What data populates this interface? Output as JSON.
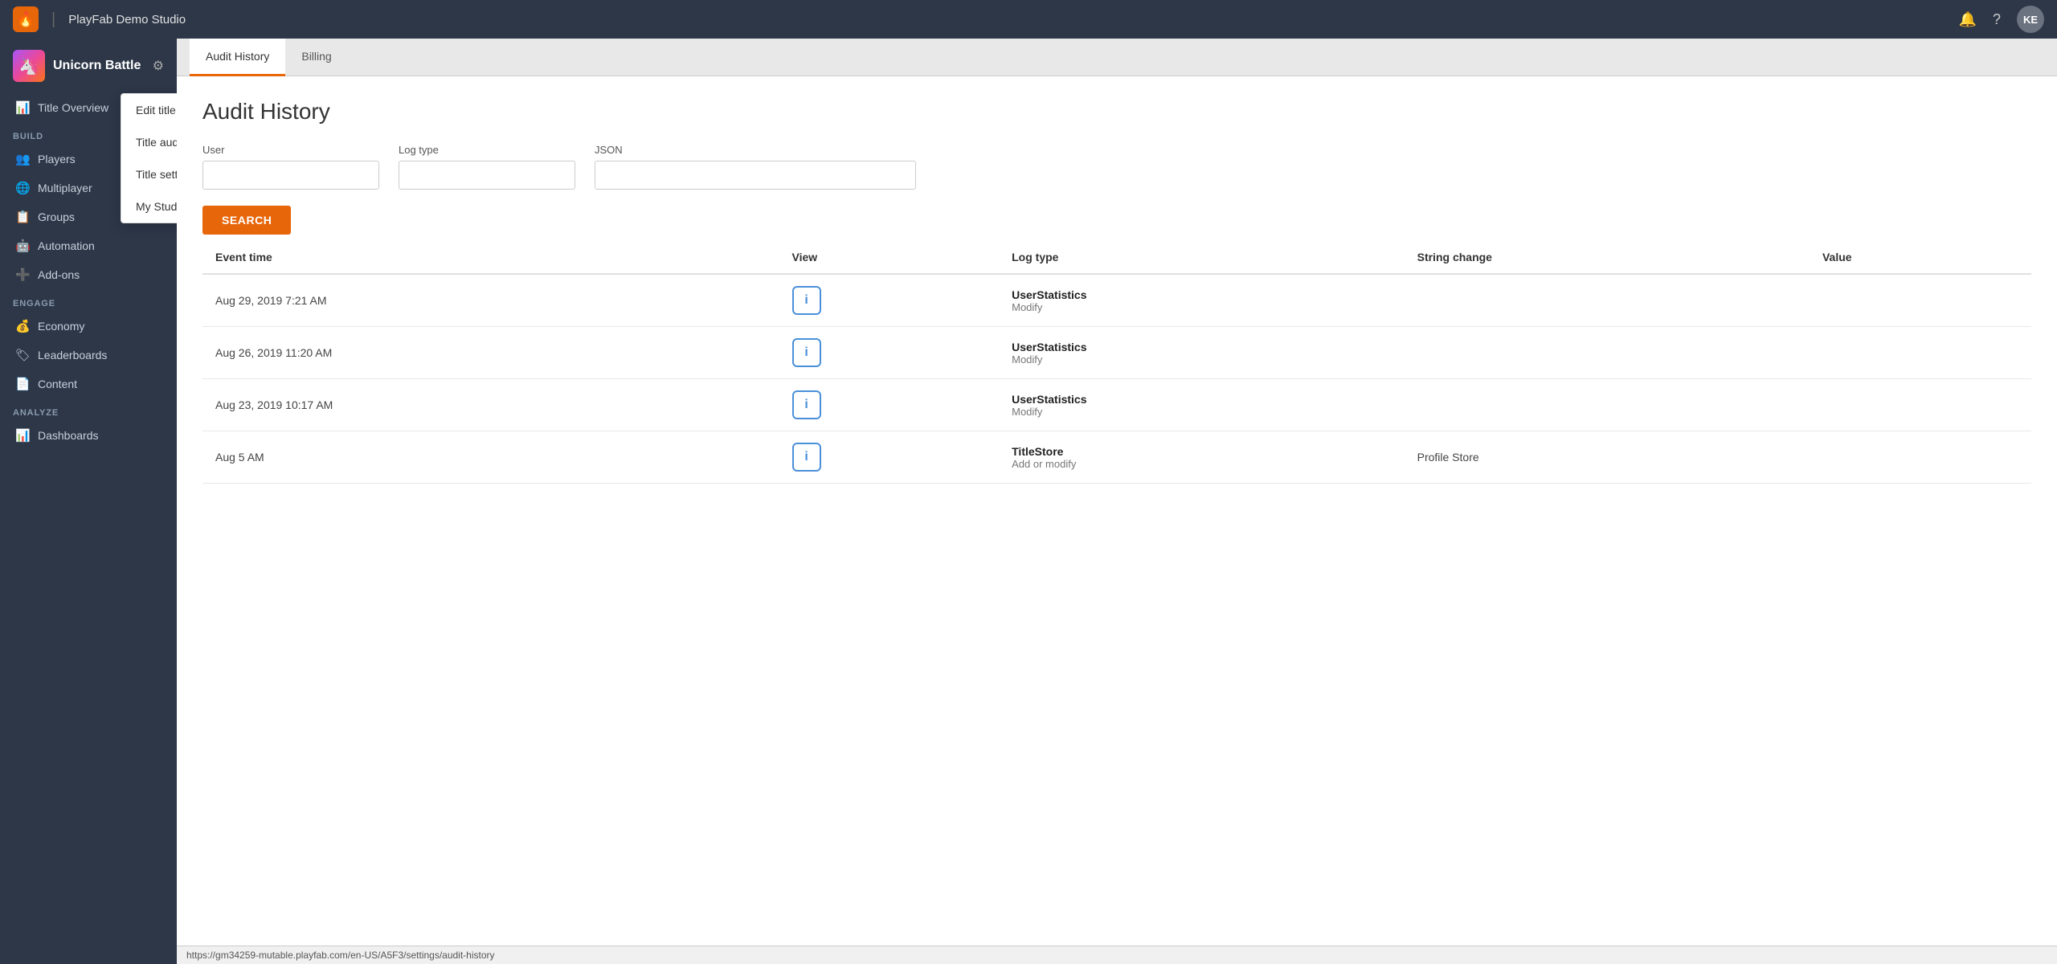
{
  "topNav": {
    "logo": "🔥",
    "studioName": "PlayFab Demo Studio",
    "divider": "|",
    "notificationIcon": "🔔",
    "helpIcon": "?",
    "avatarLabel": "KE"
  },
  "sidebar": {
    "titleName": "Unicorn Battle",
    "titleEmoji": "🦄",
    "gearLabel": "⚙",
    "overviewItem": "Title Overview",
    "buildLabel": "BUILD",
    "buildItems": [
      {
        "label": "Players",
        "icon": "👥"
      },
      {
        "label": "Multiplayer",
        "icon": "🌐"
      },
      {
        "label": "Groups",
        "icon": "📋"
      },
      {
        "label": "Automation",
        "icon": "🤖"
      },
      {
        "label": "Add-ons",
        "icon": "➕"
      }
    ],
    "engageLabel": "ENGAGE",
    "engageItems": [
      {
        "label": "Economy",
        "icon": "💰"
      },
      {
        "label": "Leaderboards",
        "icon": "🏷"
      },
      {
        "label": "Content",
        "icon": "📄"
      }
    ],
    "analyzeLabel": "ANALYZE",
    "analyzeItems": [
      {
        "label": "Dashboards",
        "icon": "📊"
      }
    ]
  },
  "dropdown": {
    "items": [
      {
        "label": "Edit title info",
        "highlighted": false
      },
      {
        "label": "Title audit history",
        "highlighted": false
      },
      {
        "label": "Title settings",
        "highlighted": false
      },
      {
        "label": "My Studios and Titles",
        "highlighted": false
      }
    ]
  },
  "tabs": [
    {
      "label": "Audit History",
      "active": true
    },
    {
      "label": "Billing",
      "active": false
    }
  ],
  "page": {
    "title": "Audit History",
    "filters": {
      "userLabel": "User",
      "userPlaceholder": "",
      "logTypeLabel": "Log type",
      "logTypePlaceholder": "",
      "jsonLabel": "JSON",
      "jsonPlaceholder": "",
      "searchButtonLabel": "SEARCH"
    },
    "table": {
      "columns": [
        "Event time",
        "View",
        "Log type",
        "String change",
        "Value"
      ],
      "rows": [
        {
          "eventTime": "Aug 29, 2019 7:21 AM",
          "logTypeName": "UserStatistics",
          "logTypeSub": "Modify",
          "stringChange": "",
          "value": ""
        },
        {
          "eventTime": "Aug 26, 2019 11:20 AM",
          "logTypeName": "UserStatistics",
          "logTypeSub": "Modify",
          "stringChange": "",
          "value": ""
        },
        {
          "eventTime": "Aug 23, 2019 10:17 AM",
          "logTypeName": "UserStatistics",
          "logTypeSub": "Modify",
          "stringChange": "",
          "value": ""
        },
        {
          "eventTime": "Aug 5 AM",
          "logTypeName": "TitleStore",
          "logTypeSub": "Add or modify",
          "stringChange": "Profile Store",
          "value": ""
        }
      ]
    }
  },
  "statusBar": {
    "url": "https://gm34259-mutable.playfab.com/en-US/A5F3/settings/audit-history"
  }
}
